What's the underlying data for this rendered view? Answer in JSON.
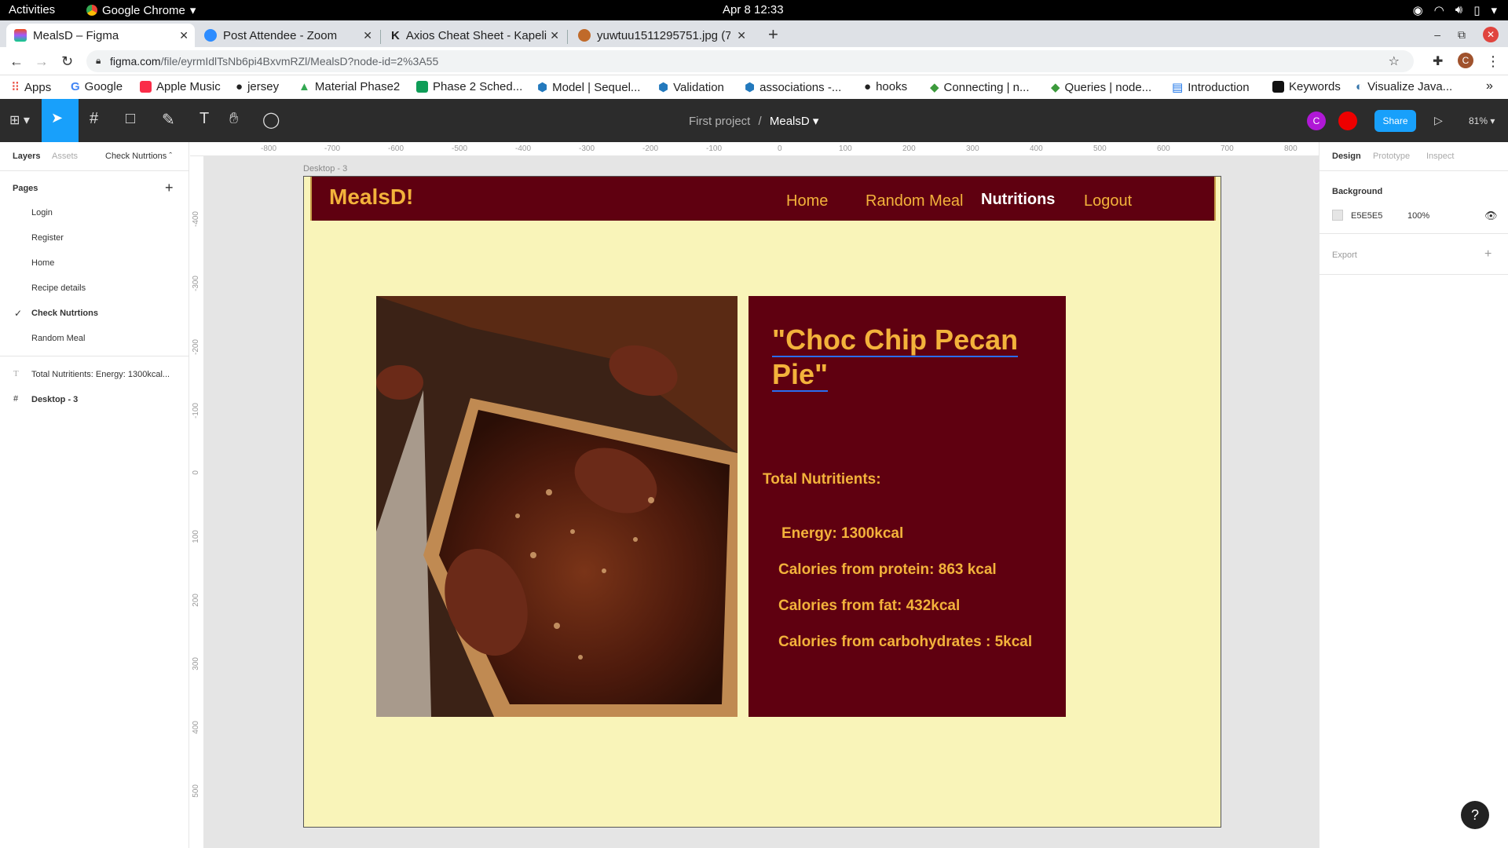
{
  "system": {
    "activities": "Activities",
    "app_name": "Google Chrome",
    "clock": "Apr 8  12:33"
  },
  "tabs": [
    {
      "label": "MealsD – Figma"
    },
    {
      "label": "Post Attendee - Zoom"
    },
    {
      "label": "Axios Cheat Sheet - Kapeli"
    },
    {
      "label": "yuwtuu1511295751.jpg (7"
    }
  ],
  "address": {
    "domain": "figma.com",
    "path": "/file/eyrmIdlTsNb6pi4BxvmRZl/MealsD?node-id=2%3A55"
  },
  "bookmarks": [
    {
      "label": "Apps"
    },
    {
      "label": "Google"
    },
    {
      "label": "Apple Music"
    },
    {
      "label": "jersey"
    },
    {
      "label": "Material Phase2"
    },
    {
      "label": "Phase 2 Sched..."
    },
    {
      "label": "Model | Sequel..."
    },
    {
      "label": "Validation"
    },
    {
      "label": "associations -..."
    },
    {
      "label": "hooks"
    },
    {
      "label": "Connecting | n..."
    },
    {
      "label": "Queries | node..."
    },
    {
      "label": "Introduction"
    },
    {
      "label": "Keywords"
    },
    {
      "label": "Visualize Java..."
    }
  ],
  "figma_toolbar": {
    "project": "First project",
    "separator": "/",
    "file": "MealsD",
    "avatar_letter": "C",
    "share_label": "Share",
    "zoom": "81%"
  },
  "left_panel": {
    "tab_layers": "Layers",
    "tab_assets": "Assets",
    "page_dropdown": "Check Nutrtions",
    "pages_label": "Pages",
    "add_icon": "+",
    "pages": [
      {
        "label": "Login"
      },
      {
        "label": "Register"
      },
      {
        "label": "Home"
      },
      {
        "label": "Recipe details"
      },
      {
        "label": "Check Nutrtions"
      },
      {
        "label": "Random Meal"
      }
    ],
    "layers": [
      {
        "label": "Total Nutritients: Energy: 1300kcal..."
      },
      {
        "label": "Desktop - 3"
      }
    ]
  },
  "right_panel": {
    "tab_design": "Design",
    "tab_prototype": "Prototype",
    "tab_inspect": "Inspect",
    "background_label": "Background",
    "bg_hex": "E5E5E5",
    "bg_opacity": "100%",
    "export_label": "Export",
    "export_add": "+"
  },
  "rulers": {
    "h": [
      "-800",
      "-700",
      "-600",
      "-500",
      "-400",
      "-300",
      "-200",
      "-100",
      "0",
      "100",
      "200",
      "300",
      "400",
      "500",
      "600",
      "700",
      "800"
    ],
    "v": [
      "-400",
      "-300",
      "-200",
      "-100",
      "0",
      "100",
      "200",
      "300",
      "400",
      "500"
    ]
  },
  "frame": {
    "label": "Desktop - 3",
    "brand": "MealsD!",
    "nav": {
      "home": "Home",
      "random": "Random Meal",
      "nutritions": "Nutritions",
      "logout": "Logout"
    },
    "recipe_title": "\"Choc Chip Pecan Pie\"",
    "total_label": "Total Nutritients:",
    "energy": "Energy: 1300kcal",
    "protein": "Calories from protein: 863 kcal",
    "fat": "Calories from fat: 432kcal",
    "carbs": "Calories from carbohydrates : 5kcal"
  },
  "help": "?",
  "colors": {
    "frame_bg": "#f9f4b9",
    "maroon": "#5f0010",
    "gold": "#f3b23b",
    "figma_blue": "#18a0fb"
  }
}
